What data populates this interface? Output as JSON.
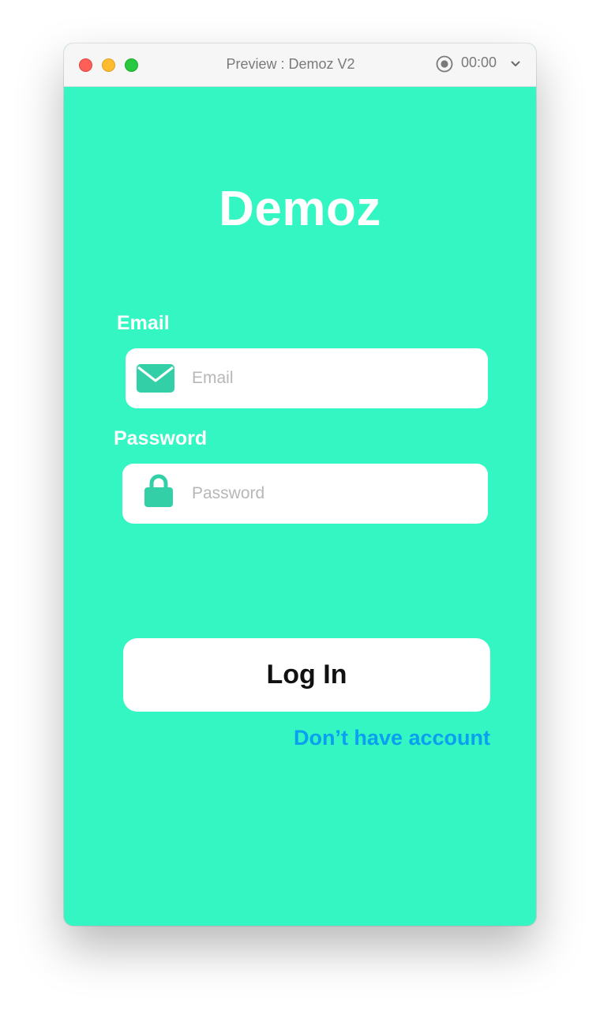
{
  "window": {
    "title": "Preview : Demoz V2",
    "timer": "00:00",
    "record_icon": "record-icon",
    "menu_icon": "chevron-down-icon"
  },
  "app": {
    "title": "Demoz",
    "background_color": "#34f6c2",
    "icon_color": "#33cfa7"
  },
  "form": {
    "email_label": "Email",
    "email_placeholder": "Email",
    "email_value": "",
    "email_icon": "envelope-icon",
    "password_label": "Password",
    "password_placeholder": "Password",
    "password_value": "",
    "password_icon": "lock-icon",
    "login_label": "Log In",
    "signup_link": "Don’t have account",
    "link_color": "#0aa0f0"
  }
}
